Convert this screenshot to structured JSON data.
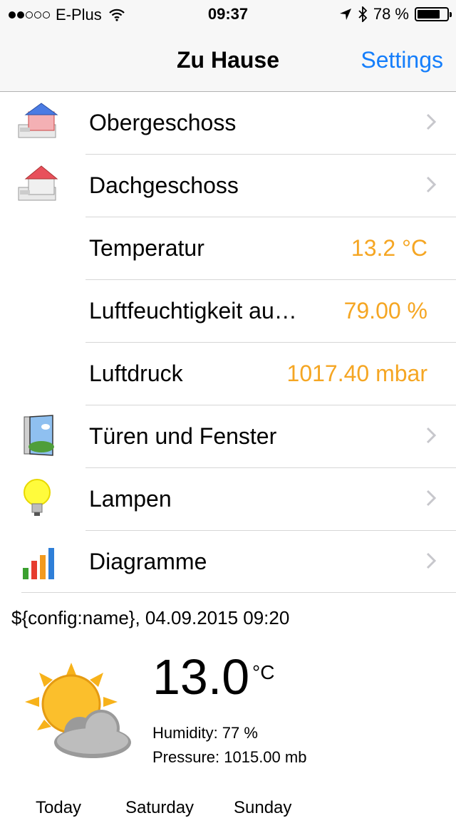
{
  "status_bar": {
    "carrier": "E-Plus",
    "time": "09:37",
    "battery": "78 %",
    "battery_level": 0.78,
    "signal_bars_filled": 2,
    "signal_bars_total": 5
  },
  "nav": {
    "title": "Zu Hause",
    "settings": "Settings",
    "accent_color": "#157efb"
  },
  "list": {
    "value_color": "#f5a623",
    "items": [
      {
        "label": "Obergeschoss",
        "icon": "house-icon"
      },
      {
        "label": "Dachgeschoss",
        "icon": "house-icon"
      },
      {
        "label": "Temperatur",
        "value": "13.2 °C"
      },
      {
        "label": "Luftfeuchtigkeit au…",
        "value": "79.00 %"
      },
      {
        "label": "Luftdruck",
        "value": "1017.40 mbar"
      },
      {
        "label": "Türen und Fenster",
        "icon": "door-window-icon"
      },
      {
        "label": "Lampen",
        "icon": "bulb-icon"
      },
      {
        "label": "Diagramme",
        "icon": "bar-chart-icon"
      }
    ]
  },
  "weather": {
    "header": "${config:name}, 04.09.2015 09:20",
    "icon": "partly-cloudy-icon",
    "temperature": "13.0",
    "unit": "°C",
    "humidity": "Humidity: 77 %",
    "pressure": "Pressure: 1015.00 mb",
    "forecast_days": [
      "Today",
      "Saturday",
      "Sunday"
    ]
  }
}
